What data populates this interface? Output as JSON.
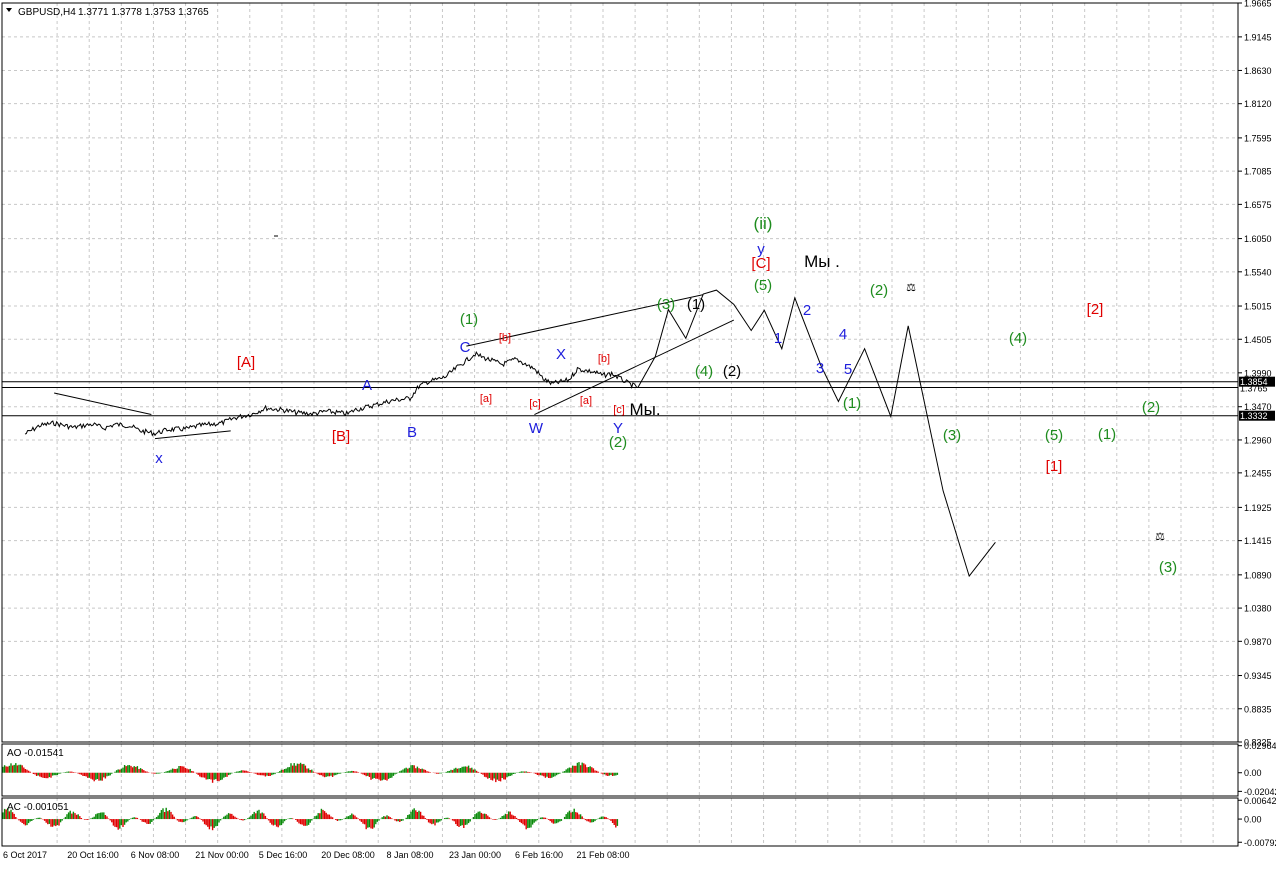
{
  "header": {
    "symbol": "GBPUSD,H4",
    "quotes": "1.3771 1.3778 1.3753 1.3765"
  },
  "colors": {
    "grid": "#c8c8c8",
    "wave_red": "#e00000",
    "wave_green": "#1e8c1e",
    "wave_blue": "#1e1edc",
    "wave_black": "#000000",
    "osc_up": "#0a8a0a",
    "osc_down": "#e00000",
    "price_label_bg": "#000000"
  },
  "chart_data": [
    {
      "type": "line",
      "panel": "main",
      "ylim": [
        0.8325,
        1.9665
      ],
      "y_ticks": [
        "1.9665",
        "1.9145",
        "1.8630",
        "1.8120",
        "1.7595",
        "1.7085",
        "1.6575",
        "1.6050",
        "1.5540",
        "1.5015",
        "1.4505",
        "1.3990",
        "1.3470",
        "1.2960",
        "1.2455",
        "1.1925",
        "1.1415",
        "1.0890",
        "1.0380",
        "0.9870",
        "0.9345",
        "0.8835",
        "0.8325"
      ],
      "price_labels": [
        {
          "label": "1.3854",
          "value": 1.3854
        },
        {
          "label": "1.3765",
          "value": 1.3765
        },
        {
          "label": "1.3332",
          "value": 1.3332
        }
      ],
      "x_labels": [
        "6 Oct 2017",
        "20 Oct 16:00",
        "6 Nov 08:00",
        "21 Nov 00:00",
        "5 Dec 16:00",
        "20 Dec 08:00",
        "8 Jan 08:00",
        "23 Jan 00:00",
        "6 Feb 16:00",
        "21 Feb 08:00"
      ],
      "series": [
        {
          "price_path": [
            [
              "6 Oct 2017",
              1.305
            ],
            [
              "9 Oct",
              1.318
            ],
            [
              "12 Oct",
              1.322
            ],
            [
              "16 Oct",
              1.315
            ],
            [
              "18 Oct",
              1.318
            ],
            [
              "20 Oct",
              1.32
            ],
            [
              "23 Oct",
              1.314
            ],
            [
              "26 Oct",
              1.32
            ],
            [
              "30 Oct",
              1.318
            ],
            [
              "2 Nov",
              1.31
            ],
            [
              "6 Nov",
              1.306
            ],
            [
              "9 Nov",
              1.312
            ],
            [
              "13 Nov",
              1.313
            ],
            [
              "16 Nov",
              1.318
            ],
            [
              "21 Nov",
              1.322
            ],
            [
              "24 Nov",
              1.33
            ],
            [
              "28 Nov",
              1.336
            ],
            [
              "1 Dec",
              1.345
            ],
            [
              "5 Dec",
              1.342
            ],
            [
              "8 Dec",
              1.338
            ],
            [
              "12 Dec",
              1.336
            ],
            [
              "15 Dec",
              1.34
            ],
            [
              "20 Dec",
              1.336
            ],
            [
              "22 Dec",
              1.342
            ],
            [
              "27 Dec",
              1.348
            ],
            [
              "2 Jan",
              1.356
            ],
            [
              "5 Jan",
              1.358
            ],
            [
              "8 Jan",
              1.36
            ],
            [
              "10 Jan",
              1.378
            ],
            [
              "12 Jan",
              1.385
            ],
            [
              "16 Jan",
              1.392
            ],
            [
              "19 Jan",
              1.408
            ],
            [
              "23 Jan",
              1.428
            ],
            [
              "25 Jan",
              1.422
            ],
            [
              "29 Jan",
              1.412
            ],
            [
              "1 Feb",
              1.42
            ],
            [
              "5 Feb",
              1.405
            ],
            [
              "7 Feb",
              1.39
            ],
            [
              "9 Feb",
              1.382
            ],
            [
              "13 Feb",
              1.388
            ],
            [
              "15 Feb",
              1.405
            ],
            [
              "19 Feb",
              1.4
            ],
            [
              "21 Feb",
              1.395
            ],
            [
              "23 Feb",
              1.398
            ],
            [
              "27 Feb",
              1.382
            ],
            [
              "1 Mar",
              1.3765
            ]
          ],
          "forecast_path": [
            [
              "1 Mar",
              1.3765
            ],
            [
              "5 Mar",
              1.424
            ],
            [
              "8 Mar",
              1.496
            ],
            [
              "12 Mar",
              1.452
            ],
            [
              "16 Mar",
              1.52
            ],
            [
              "19 Mar",
              1.526
            ],
            [
              "23 Mar",
              1.504
            ],
            [
              "27 Mar",
              1.464
            ],
            [
              "30 Mar",
              1.495
            ],
            [
              "3 Apr",
              1.436
            ],
            [
              "6 Apr",
              1.514
            ],
            [
              "12 Apr",
              1.41
            ],
            [
              "16 Apr",
              1.355
            ],
            [
              "22 Apr",
              1.436
            ],
            [
              "28 Apr",
              1.332
            ],
            [
              "2 May",
              1.471
            ],
            [
              "10 May",
              1.218
            ],
            [
              "16 May",
              1.087
            ],
            [
              "22 May",
              1.139
            ]
          ]
        }
      ],
      "wave_labels": [
        {
          "text": "x",
          "color": "blue"
        },
        {
          "text": "[A]",
          "color": "red"
        },
        {
          "text": "[B]",
          "color": "red"
        },
        {
          "text": "A",
          "color": "blue"
        },
        {
          "text": "B",
          "color": "blue"
        },
        {
          "text": "(1)",
          "color": "green"
        },
        {
          "text": "C",
          "color": "blue"
        },
        {
          "text": "[b]",
          "color": "red"
        },
        {
          "text": "[a]",
          "color": "red"
        },
        {
          "text": "[c]",
          "color": "red"
        },
        {
          "text": "W",
          "color": "blue"
        },
        {
          "text": "X",
          "color": "blue"
        },
        {
          "text": "[b]",
          "color": "red"
        },
        {
          "text": "[a]",
          "color": "red"
        },
        {
          "text": "[c]",
          "color": "red"
        },
        {
          "text": "Мы.",
          "color": "black"
        },
        {
          "text": "Y",
          "color": "blue"
        },
        {
          "text": "(2)",
          "color": "green"
        },
        {
          "text": "(3)",
          "color": "green"
        },
        {
          "text": "(1)",
          "color": "black"
        },
        {
          "text": "(4)",
          "color": "green"
        },
        {
          "text": "(2)",
          "color": "black"
        },
        {
          "text": "(ii)",
          "color": "green"
        },
        {
          "text": "y",
          "color": "blue"
        },
        {
          "text": "[C]",
          "color": "red"
        },
        {
          "text": "(5)",
          "color": "green"
        },
        {
          "text": "Мы .",
          "color": "black"
        },
        {
          "text": "1",
          "color": "blue"
        },
        {
          "text": "2",
          "color": "blue"
        },
        {
          "text": "3",
          "color": "blue"
        },
        {
          "text": "4",
          "color": "blue"
        },
        {
          "text": "5",
          "color": "blue"
        },
        {
          "text": "(1)",
          "color": "green"
        },
        {
          "text": "(2)",
          "color": "green"
        },
        {
          "text": "(3)",
          "color": "green"
        },
        {
          "text": "(4)",
          "color": "green"
        },
        {
          "text": "(5)",
          "color": "green"
        },
        {
          "text": "[1]",
          "color": "red"
        },
        {
          "text": "[2]",
          "color": "red"
        },
        {
          "text": "(2)",
          "color": "green"
        },
        {
          "text": "(1)",
          "color": "green"
        },
        {
          "text": "(3)",
          "color": "green"
        }
      ]
    },
    {
      "type": "bar",
      "panel": "ao",
      "title": "AO -0.01541",
      "y_ticks": [
        "0.02964",
        "0.00",
        "-0.02042"
      ],
      "ylim": [
        -0.0255,
        0.0315
      ]
    },
    {
      "type": "bar",
      "panel": "ac",
      "title": "AC -0.001051",
      "y_ticks": [
        "0.006426",
        "0.00",
        "-0.00792"
      ],
      "ylim": [
        -0.0092,
        0.0072
      ]
    }
  ]
}
